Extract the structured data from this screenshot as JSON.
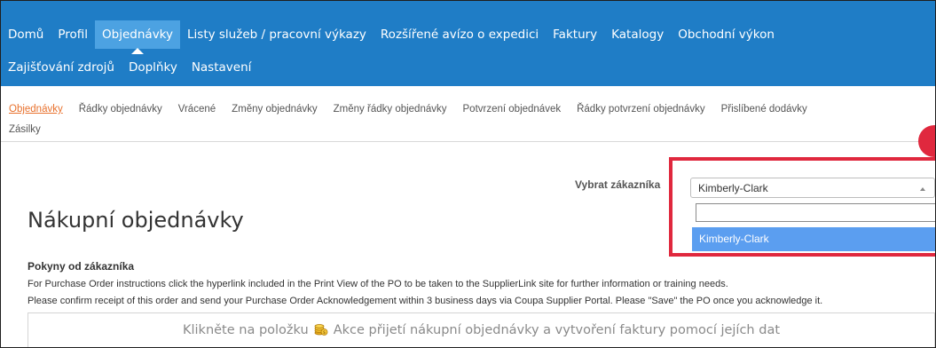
{
  "nav": {
    "row1": [
      {
        "label": "Domů",
        "active": false
      },
      {
        "label": "Profil",
        "active": false
      },
      {
        "label": "Objednávky",
        "active": true
      },
      {
        "label": "Listy služeb / pracovní výkazy",
        "active": false
      },
      {
        "label": "Rozšířené avízo o expedici",
        "active": false
      },
      {
        "label": "Faktury",
        "active": false
      },
      {
        "label": "Katalogy",
        "active": false
      },
      {
        "label": "Obchodní výkon",
        "active": false
      }
    ],
    "row2": [
      {
        "label": "Zajišťování zdrojů",
        "active": false
      },
      {
        "label": "Doplňky",
        "active": false
      },
      {
        "label": "Nastavení",
        "active": false
      }
    ]
  },
  "subnav": {
    "row1": [
      {
        "label": "Objednávky",
        "active": true
      },
      {
        "label": "Řádky objednávky",
        "active": false
      },
      {
        "label": "Vrácené",
        "active": false
      },
      {
        "label": "Změny objednávky",
        "active": false
      },
      {
        "label": "Změny řádky objednávky",
        "active": false
      },
      {
        "label": "Potvrzení objednávek",
        "active": false
      },
      {
        "label": "Řádky potvrzení objednávky",
        "active": false
      },
      {
        "label": "Přislíbené dodávky",
        "active": false
      }
    ],
    "row2": [
      {
        "label": "Zásilky",
        "active": false
      }
    ]
  },
  "customer_select": {
    "label": "Vybrat zákazníka",
    "selected": "Kimberly-Clark",
    "search_value": "",
    "options": [
      "Kimberly-Clark"
    ]
  },
  "page": {
    "title": "Nákupní objednávky",
    "instructions_heading": "Pokyny od zákazníka",
    "instructions": [
      "For Purchase Order instructions click the hyperlink included in the Print View of the PO to be taken to the SupplierLink site for further information or training needs.",
      "Please confirm receipt of this order and send your Purchase Order Acknowledgement within 3 business days via Coupa Supplier Portal. Please \"Save\" the PO once you acknowledge it."
    ],
    "banner": {
      "before_icon": "Klikněte na položku",
      "icon": "coins-icon",
      "after_icon": "Akce přijetí nákupní objednávky a vytvoření faktury pomocí jejích dat"
    }
  },
  "colors": {
    "nav_bg": "#1f7dc6",
    "nav_active": "#4ca2e2",
    "subnav_active": "#e8712d",
    "highlight": "#e0283e",
    "option_selected": "#5b9ef0"
  }
}
